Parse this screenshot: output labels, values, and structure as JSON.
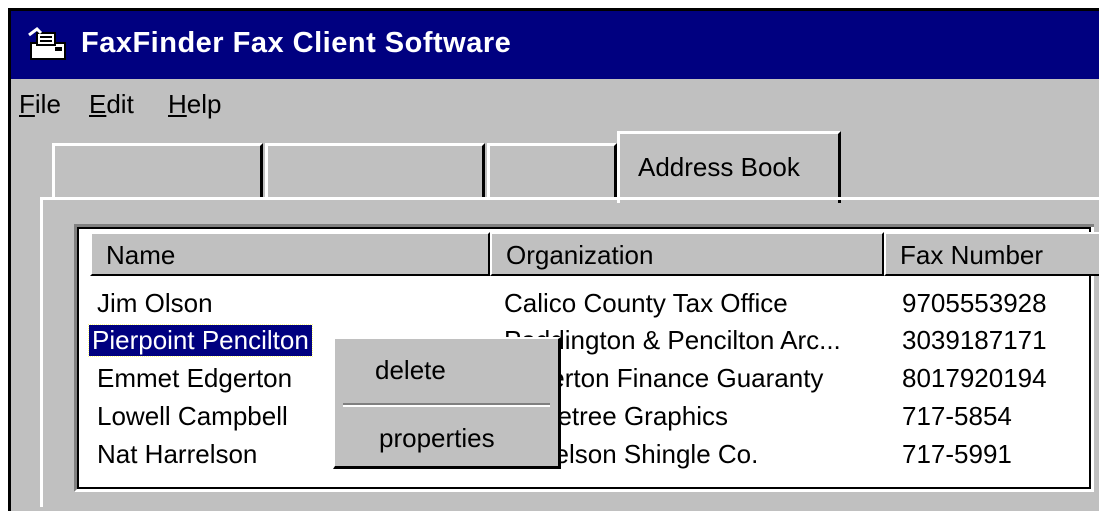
{
  "window": {
    "title": "FaxFinder Fax Client Software"
  },
  "menu": {
    "file": {
      "u": "F",
      "rest": "ile"
    },
    "edit": {
      "u": "E",
      "rest": "dit"
    },
    "help": {
      "u": "H",
      "rest": "elp"
    }
  },
  "tabs": [
    {
      "label": ""
    },
    {
      "label": ""
    },
    {
      "label": ""
    },
    {
      "label": "Address Book",
      "active": true
    }
  ],
  "address_book": {
    "columns": [
      "Name",
      "Organization",
      "Fax Number"
    ],
    "rows": [
      {
        "name": "Jim Olson",
        "organization": "Calico County Tax Office",
        "fax": "9705553928"
      },
      {
        "name": "Pierpoint Pencilton",
        "organization": "Paddington & Pencilton Arc...",
        "fax": "3039187171",
        "selected": true
      },
      {
        "name": "Emmet Edgerton",
        "organization": "Edgerton Finance Guaranty",
        "fax": "8017920194"
      },
      {
        "name": "Lowell Campbell",
        "organization": "Threetree Graphics",
        "fax": "717-5854"
      },
      {
        "name": "Nat Harrelson",
        "organization": "Harrelson Shingle Co.",
        "fax": "717-5991"
      }
    ]
  },
  "context_menu": {
    "items": [
      "delete",
      "properties"
    ]
  },
  "colors": {
    "title_bar": "#000080",
    "face": "#c0c0c0",
    "selection": "#000080"
  },
  "icons": {
    "app": "fax-machine-icon"
  }
}
